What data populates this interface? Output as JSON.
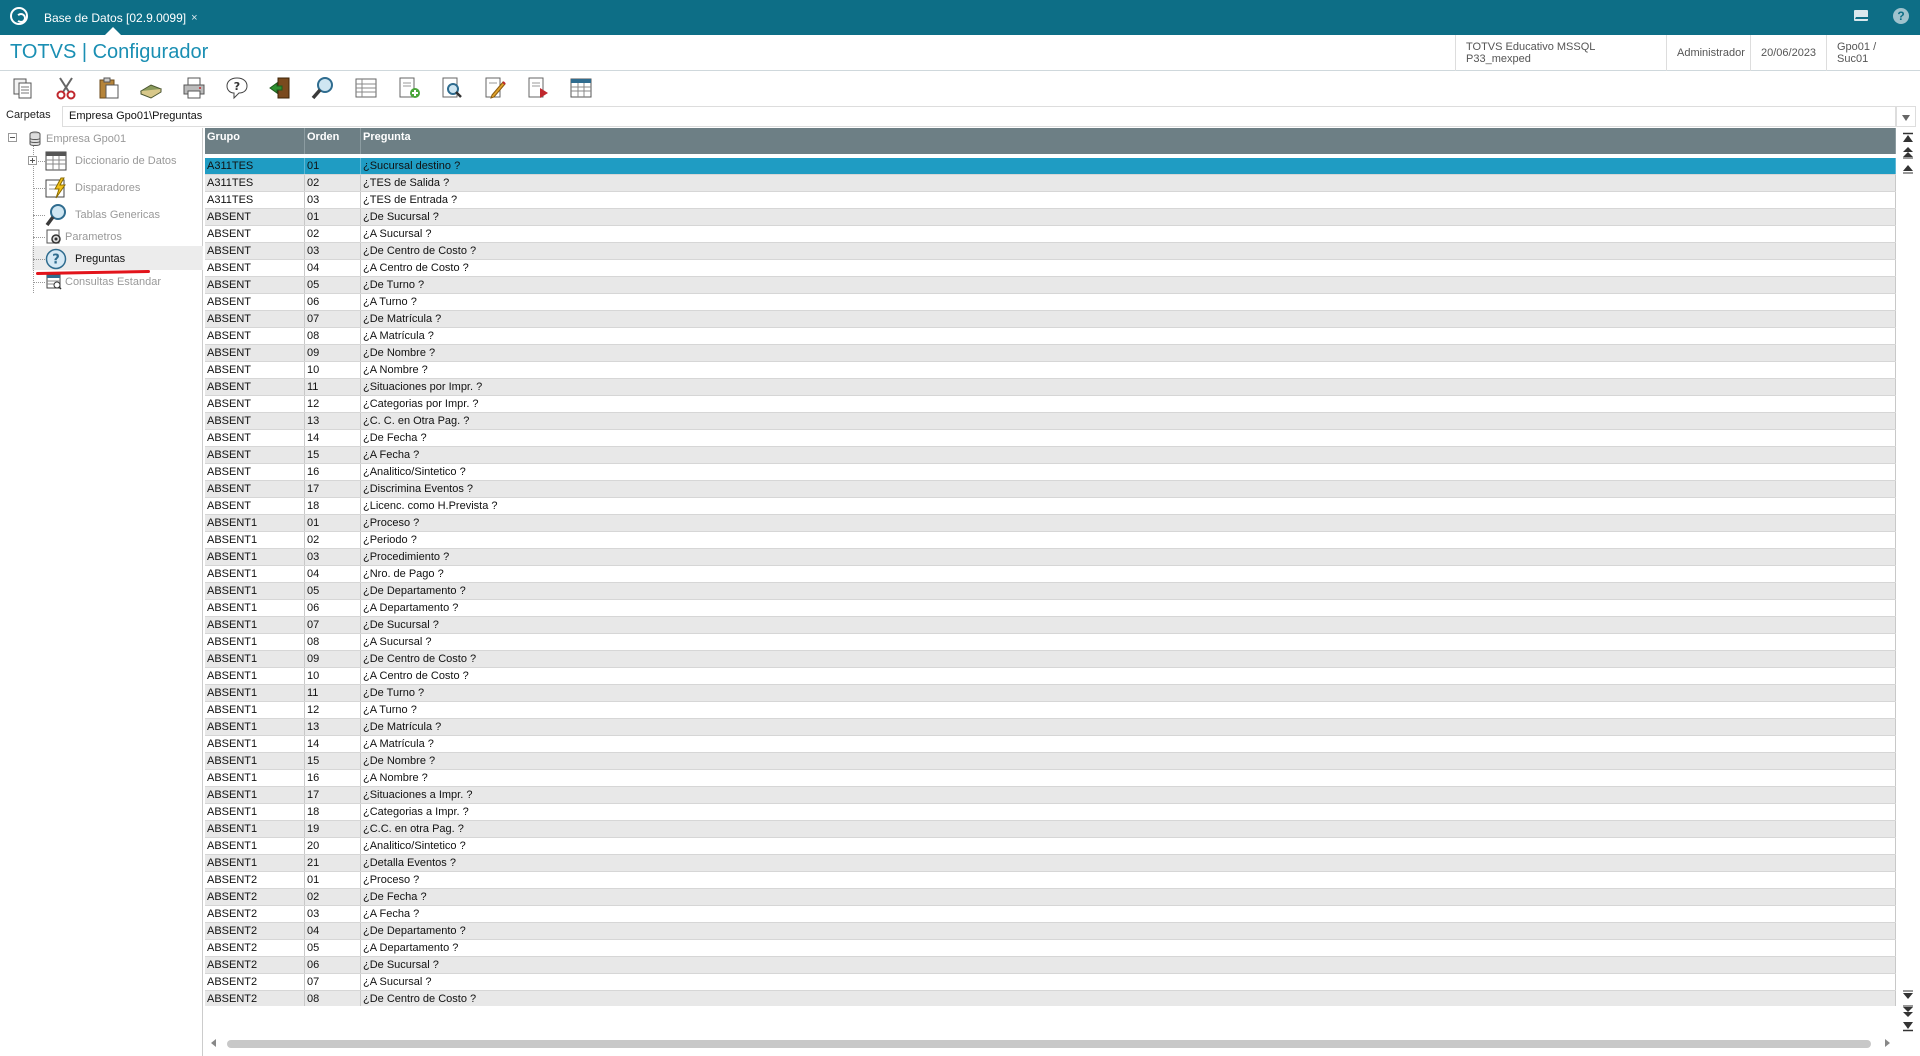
{
  "titlebar": {
    "tab_label": "Base de Datos [02.9.0099]",
    "tab_close": "×",
    "icons": [
      "app-logo-icon",
      "mail-icon",
      "help-icon"
    ],
    "help_glyph": "?"
  },
  "header": {
    "brand": "TOTVS | Configurador",
    "environment": "TOTVS Educativo MSSQL P33_mexped",
    "user": "Administrador",
    "date": "20/06/2023",
    "company": "Gpo01 / Suc01"
  },
  "toolbar": {
    "buttons": [
      "copy-icon",
      "cut-icon",
      "paste-icon",
      "book-icon",
      "print-icon",
      "help-question-icon",
      "exit-door-icon",
      "search-magnifier-icon",
      "list-view-icon",
      "add-document-icon",
      "find-document-icon",
      "edit-document-icon",
      "delete-document-icon",
      "table-view-icon"
    ]
  },
  "folder": {
    "label": "Carpetas",
    "path": "Empresa Gpo01\\Preguntas"
  },
  "tree": {
    "root": "Empresa Gpo01",
    "items": [
      {
        "label": "Diccionario de Datos",
        "icon": "dictionary-table-icon"
      },
      {
        "label": "Disparadores",
        "icon": "trigger-lightning-icon"
      },
      {
        "label": "Tablas Genericas",
        "icon": "magnifier-icon"
      },
      {
        "label": "Parametros",
        "icon": "parameters-gear-icon"
      },
      {
        "label": "Preguntas",
        "icon": "question-circle-icon",
        "selected": true
      },
      {
        "label": "Consultas Estandar",
        "icon": "query-table-icon"
      }
    ],
    "accent_color": "#e2141b"
  },
  "grid": {
    "columns": [
      "Grupo",
      "Orden",
      "Pregunta"
    ],
    "selected_color": "#1f9cc3",
    "rows": [
      [
        "A311TES",
        "01",
        "¿Sucursal destino ?"
      ],
      [
        "A311TES",
        "02",
        "¿TES de Salida ?"
      ],
      [
        "A311TES",
        "03",
        "¿TES de Entrada ?"
      ],
      [
        "ABSENT",
        "01",
        "¿De Sucursal ?"
      ],
      [
        "ABSENT",
        "02",
        "¿A Sucursal ?"
      ],
      [
        "ABSENT",
        "03",
        "¿De Centro de Costo ?"
      ],
      [
        "ABSENT",
        "04",
        "¿A Centro de Costo ?"
      ],
      [
        "ABSENT",
        "05",
        "¿De Turno ?"
      ],
      [
        "ABSENT",
        "06",
        "¿A Turno ?"
      ],
      [
        "ABSENT",
        "07",
        "¿De Matrícula ?"
      ],
      [
        "ABSENT",
        "08",
        "¿A Matrícula ?"
      ],
      [
        "ABSENT",
        "09",
        "¿De Nombre ?"
      ],
      [
        "ABSENT",
        "10",
        "¿A Nombre ?"
      ],
      [
        "ABSENT",
        "11",
        "¿Situaciones por Impr. ?"
      ],
      [
        "ABSENT",
        "12",
        "¿Categorias por Impr. ?"
      ],
      [
        "ABSENT",
        "13",
        "¿C. C. en Otra Pag. ?"
      ],
      [
        "ABSENT",
        "14",
        "¿De Fecha ?"
      ],
      [
        "ABSENT",
        "15",
        "¿A Fecha ?"
      ],
      [
        "ABSENT",
        "16",
        "¿Analitico/Sintetico ?"
      ],
      [
        "ABSENT",
        "17",
        "¿Discrimina Eventos ?"
      ],
      [
        "ABSENT",
        "18",
        "¿Licenc. como H.Prevista ?"
      ],
      [
        "ABSENT1",
        "01",
        "¿Proceso ?"
      ],
      [
        "ABSENT1",
        "02",
        "¿Periodo ?"
      ],
      [
        "ABSENT1",
        "03",
        "¿Procedimiento ?"
      ],
      [
        "ABSENT1",
        "04",
        "¿Nro. de Pago ?"
      ],
      [
        "ABSENT1",
        "05",
        "¿De Departamento ?"
      ],
      [
        "ABSENT1",
        "06",
        "¿A Departamento ?"
      ],
      [
        "ABSENT1",
        "07",
        "¿De Sucursal ?"
      ],
      [
        "ABSENT1",
        "08",
        "¿A Sucursal ?"
      ],
      [
        "ABSENT1",
        "09",
        "¿De Centro de Costo ?"
      ],
      [
        "ABSENT1",
        "10",
        "¿A Centro de Costo ?"
      ],
      [
        "ABSENT1",
        "11",
        "¿De Turno ?"
      ],
      [
        "ABSENT1",
        "12",
        "¿A Turno ?"
      ],
      [
        "ABSENT1",
        "13",
        "¿De Matrícula ?"
      ],
      [
        "ABSENT1",
        "14",
        "¿A Matrícula ?"
      ],
      [
        "ABSENT1",
        "15",
        "¿De Nombre ?"
      ],
      [
        "ABSENT1",
        "16",
        "¿A Nombre ?"
      ],
      [
        "ABSENT1",
        "17",
        "¿Situaciones a Impr. ?"
      ],
      [
        "ABSENT1",
        "18",
        "¿Categorias a Impr. ?"
      ],
      [
        "ABSENT1",
        "19",
        "¿C.C. en otra Pag. ?"
      ],
      [
        "ABSENT1",
        "20",
        "¿Analitico/Sintetico ?"
      ],
      [
        "ABSENT1",
        "21",
        "¿Detalla Eventos ?"
      ],
      [
        "ABSENT2",
        "01",
        "¿Proceso ?"
      ],
      [
        "ABSENT2",
        "02",
        "¿De Fecha ?"
      ],
      [
        "ABSENT2",
        "03",
        "¿A Fecha ?"
      ],
      [
        "ABSENT2",
        "04",
        "¿De Departamento ?"
      ],
      [
        "ABSENT2",
        "05",
        "¿A Departamento ?"
      ],
      [
        "ABSENT2",
        "06",
        "¿De Sucursal ?"
      ],
      [
        "ABSENT2",
        "07",
        "¿A Sucursal ?"
      ],
      [
        "ABSENT2",
        "08",
        "¿De Centro de Costo ?"
      ]
    ]
  }
}
